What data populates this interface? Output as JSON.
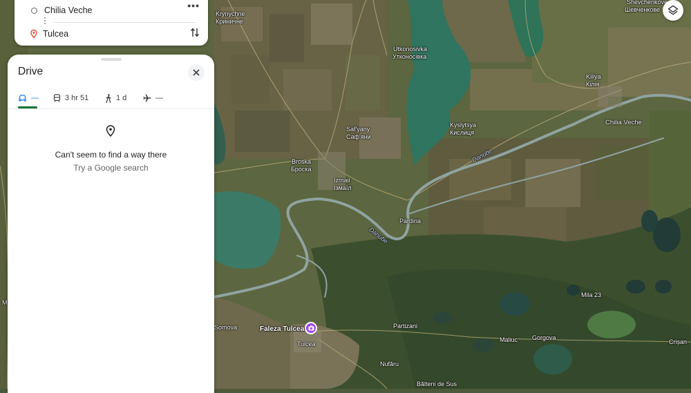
{
  "route": {
    "origin": "Chilia Veche",
    "destination": "Tulcea",
    "more_icon": "more-horiz-icon",
    "swap_icon": "swap-vert-icon"
  },
  "panel": {
    "title": "Drive",
    "close_icon": "close-icon",
    "tabs": [
      {
        "icon": "car-icon",
        "label": "—"
      },
      {
        "icon": "transit-icon",
        "label": "3 hr 51"
      },
      {
        "icon": "walk-icon",
        "label": "1 d"
      },
      {
        "icon": "flight-icon",
        "label": "—"
      }
    ],
    "empty_title": "Can't seem to find a way there",
    "empty_subtitle": "Try a Google search"
  },
  "map": {
    "labels": {
      "krynychne": "Krynychne",
      "krynychne_cyr": "Криничне",
      "shevchenkove": "Shevchenkove",
      "shevchenkove_cyr": "Шевченкове",
      "utkonosivka": "Utkonosivka",
      "utkonosivka_cyr": "Утконосівка",
      "kiliya": "Kiliya",
      "kiliya_cyr": "Кілія",
      "chilia_veche": "Chilia Veche",
      "kyslytsya": "Kyslytsya",
      "kyslytsya_cyr": "Кислиця",
      "safyany": "Saf'yany",
      "safyany_cyr": "Саф'яни",
      "broska": "Broska",
      "broska_cyr": "Броска",
      "izmail": "Izmail",
      "izmail_cyr": "Ізмаїл",
      "danube_1": "Danube",
      "danube_2": "Danube",
      "pardina": "Pardina",
      "mila23": "Mila 23",
      "somova": "Somova",
      "faleza_tulcea": "Faleza Tulcea",
      "tulcea": "Tulcea",
      "partizani": "Partizani",
      "maliuc": "Maliuc",
      "gorgova": "Gorgova",
      "crisan": "Crișan",
      "nufaru": "Nufăru",
      "baltenii": "Bălteni de Sus",
      "edge_m": "M"
    },
    "layers_icon": "layers-icon",
    "poi_icon": "camera-icon",
    "colors": {
      "land": "#5c6640",
      "field_dark": "#4b4a33",
      "field_light": "#776d52",
      "field_green": "#556b3c",
      "marsh": "#334a2b",
      "water": "#2f6f5c",
      "lake": "#3b7a66",
      "river": "#8fa3a1",
      "road": "#c4b27c"
    }
  }
}
